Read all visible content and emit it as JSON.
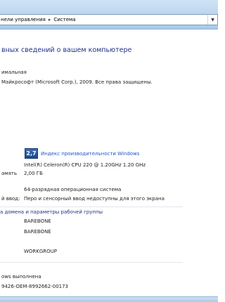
{
  "address": {
    "crumbs": [
      "нели управления",
      "Система"
    ],
    "dropdown_icon": "chevron-down-icon"
  },
  "page": {
    "heading": "вных сведений о вашем компьютере"
  },
  "edition": {
    "edition_name": "имальная",
    "copyright": "Майкрософт (Microsoft Corp.), 2009. Все права защищены."
  },
  "system": {
    "score": "2,7",
    "score_link": "Индекс производительности Windows",
    "cpu": "Intel(R) Celeron(R) CPU        220  @ 1.20GHz   1.20 GHz",
    "ram_label": "амять",
    "ram_value": "2,00 ГБ",
    "type_value": "64-разрядная операционная система",
    "pen_label": "й ввод:",
    "pen_value": "Перо и сенсорный ввод недоступны для этого экрана"
  },
  "computer": {
    "section_title": "а домена и параметры рабочей группы",
    "name": "BAREBONE",
    "full_name": "BAREBONE",
    "workgroup": "WORKGROUP"
  },
  "activation": {
    "status": "ows выполнена",
    "product_id": "9426-OEM-8992662-00173"
  }
}
